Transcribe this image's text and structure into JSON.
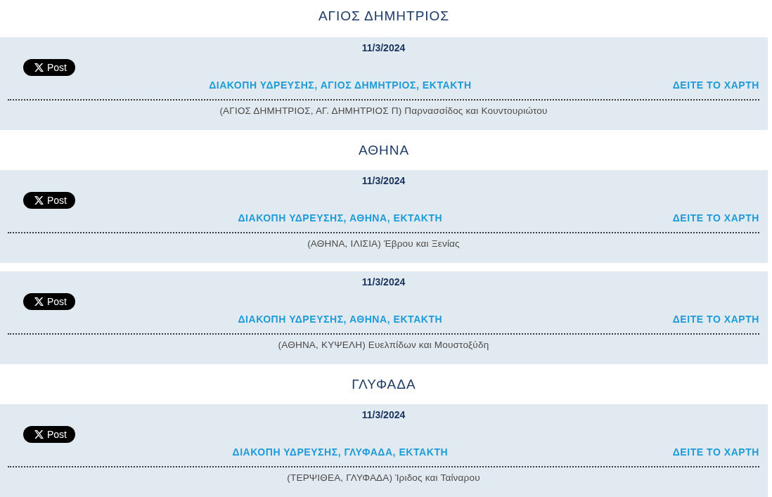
{
  "groups": [
    {
      "heading": "ΑΓΙΟΣ ΔΗΜΗΤΡΙΟΣ",
      "notices": [
        {
          "date": "11/3/2024",
          "share_button": "Post",
          "title": "ΔΙΑΚΟΠΗ ΥΔΡΕΥΣΗΣ, ΑΓΙΟΣ ΔΗΜΗΤΡΙΟΣ, ΕΚΤΑΚΤΗ",
          "map_link": "ΔΕΙΤΕ ΤΟ ΧΑΡΤΗ",
          "description": "(ΑΓΙΟΣ ΔΗΜΗΤΡΙΟΣ, ΑΓ. ΔΗΜΗΤΡΙΟΣ Π) Παρνασσίδος και Κουντουριώτου"
        }
      ]
    },
    {
      "heading": "ΑΘΗΝΑ",
      "notices": [
        {
          "date": "11/3/2024",
          "share_button": "Post",
          "title": "ΔΙΑΚΟΠΗ ΥΔΡΕΥΣΗΣ, ΑΘΗΝΑ, ΕΚΤΑΚΤΗ",
          "map_link": "ΔΕΙΤΕ ΤΟ ΧΑΡΤΗ",
          "description": "(ΑΘΗΝΑ, ΙΛΙΣΙΑ) Έβρου και Ξενίας"
        },
        {
          "date": "11/3/2024",
          "share_button": "Post",
          "title": "ΔΙΑΚΟΠΗ ΥΔΡΕΥΣΗΣ, ΑΘΗΝΑ, ΕΚΤΑΚΤΗ",
          "map_link": "ΔΕΙΤΕ ΤΟ ΧΑΡΤΗ",
          "description": "(ΑΘΗΝΑ, ΚΥΨΕΛΗ) Ευελπίδων και Μουστοξύδη"
        }
      ]
    },
    {
      "heading": "ΓΛΥΦΑΔΑ",
      "notices": [
        {
          "date": "11/3/2024",
          "share_button": "Post",
          "title": "ΔΙΑΚΟΠΗ ΥΔΡΕΥΣΗΣ, ΓΛΥΦΑΔΑ, ΕΚΤΑΚΤΗ",
          "map_link": "ΔΕΙΤΕ ΤΟ ΧΑΡΤΗ",
          "description": "(ΤΕΡΨΙΘΕΑ, ΓΛΥΦΑΔΑ) Ίριδος και Ταίναρου"
        }
      ]
    }
  ]
}
